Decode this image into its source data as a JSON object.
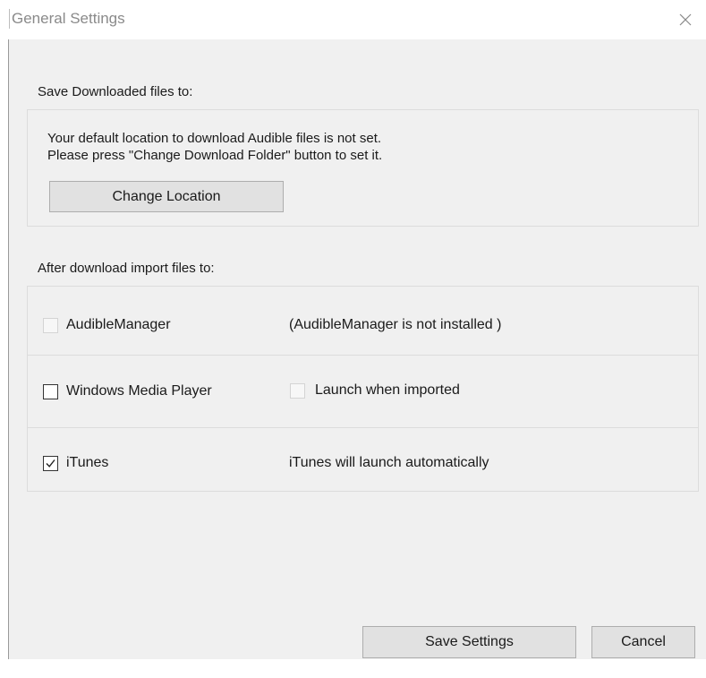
{
  "window": {
    "title": "General Settings",
    "close_icon": "close-icon"
  },
  "download_section": {
    "label": "Save Downloaded files to:",
    "message_line1": "Your default location to download Audible files is not set.",
    "message_line2": "Please press \"Change Download Folder\" button to set it.",
    "change_button_label": "Change Location"
  },
  "import_section": {
    "label": "After download import files to:",
    "rows": [
      {
        "name": "AudibleManager",
        "checked": false,
        "enabled": false,
        "note": "(AudibleManager is not installed )"
      },
      {
        "name": "Windows Media Player",
        "checked": false,
        "enabled": true,
        "option_label": "Launch when imported",
        "option_checked": false,
        "option_enabled": false
      },
      {
        "name": "iTunes",
        "checked": true,
        "enabled": true,
        "note": "iTunes will launch automatically"
      }
    ]
  },
  "footer": {
    "save_label": "Save Settings",
    "cancel_label": "Cancel"
  },
  "colors": {
    "dialog_bg": "#f0f0f0",
    "button_bg": "#e1e1e1",
    "button_border": "#adadad",
    "title_text": "#8a8a8a"
  }
}
